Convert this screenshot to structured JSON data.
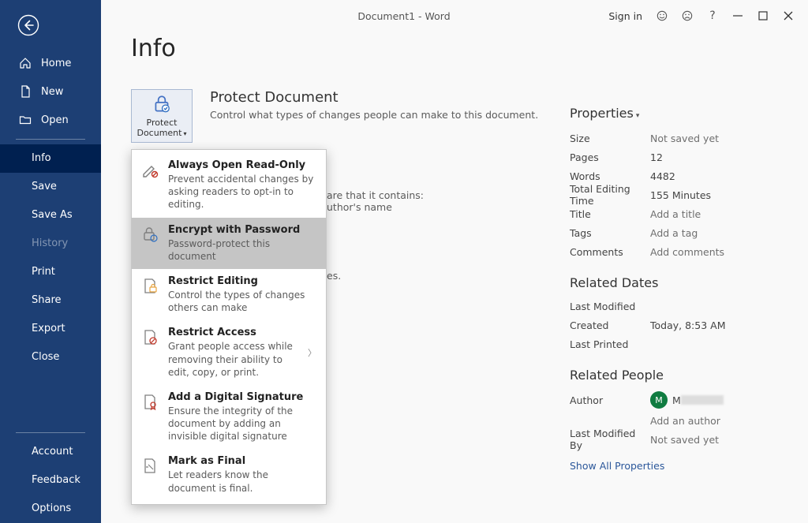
{
  "titlebar": {
    "doc_title": "Document1  -  Word",
    "signin": "Sign in"
  },
  "sidebar": {
    "main": [
      {
        "label": "Home",
        "icon": "home"
      },
      {
        "label": "New",
        "icon": "new"
      },
      {
        "label": "Open",
        "icon": "open"
      }
    ],
    "secondary": [
      {
        "label": "Info",
        "selected": true
      },
      {
        "label": "Save"
      },
      {
        "label": "Save As"
      },
      {
        "label": "History",
        "disabled": true
      },
      {
        "label": "Print"
      },
      {
        "label": "Share"
      },
      {
        "label": "Export"
      },
      {
        "label": "Close"
      }
    ],
    "footer": [
      {
        "label": "Account"
      },
      {
        "label": "Feedback"
      },
      {
        "label": "Options"
      }
    ]
  },
  "page": {
    "title": "Info"
  },
  "protect": {
    "button_label1": "Protect",
    "button_label2": "Document",
    "title": "Protect Document",
    "desc": "Control what types of changes people can make to this document.",
    "menu": [
      {
        "title": "Always Open Read-Only",
        "desc": "Prevent accidental changes by asking readers to opt-in to editing."
      },
      {
        "title": "Encrypt with Password",
        "desc": "Password-protect this document",
        "highlight": true
      },
      {
        "title": "Restrict Editing",
        "desc": "Control the types of changes others can make"
      },
      {
        "title": "Restrict Access",
        "desc": "Grant people access while removing their ability to edit, copy, or print.",
        "submenu": true
      },
      {
        "title": "Add a Digital Signature",
        "desc": "Ensure the integrity of the document by adding an invisible digital signature"
      },
      {
        "title": "Mark as Final",
        "desc": "Let readers know the document is final."
      }
    ]
  },
  "inspect_fragments": {
    "line1": "are that it contains:",
    "line2": "uthor's name",
    "line3": "es."
  },
  "properties": {
    "header": "Properties",
    "rows": [
      {
        "k": "Size",
        "v": "Not saved yet",
        "placeholder": true
      },
      {
        "k": "Pages",
        "v": "12"
      },
      {
        "k": "Words",
        "v": "4482"
      },
      {
        "k": "Total Editing Time",
        "v": "155 Minutes"
      },
      {
        "k": "Title",
        "v": "Add a title",
        "placeholder": true
      },
      {
        "k": "Tags",
        "v": "Add a tag",
        "placeholder": true
      },
      {
        "k": "Comments",
        "v": "Add comments",
        "placeholder": true
      }
    ],
    "related_dates_header": "Related Dates",
    "dates": [
      {
        "k": "Last Modified",
        "v": ""
      },
      {
        "k": "Created",
        "v": "Today, 8:53 AM"
      },
      {
        "k": "Last Printed",
        "v": ""
      }
    ],
    "related_people_header": "Related People",
    "author_label": "Author",
    "author_initial": "M",
    "author_name": "M",
    "add_author": "Add an author",
    "last_modified_by_label": "Last Modified By",
    "last_modified_by_value": "Not saved yet",
    "show_all": "Show All Properties"
  }
}
